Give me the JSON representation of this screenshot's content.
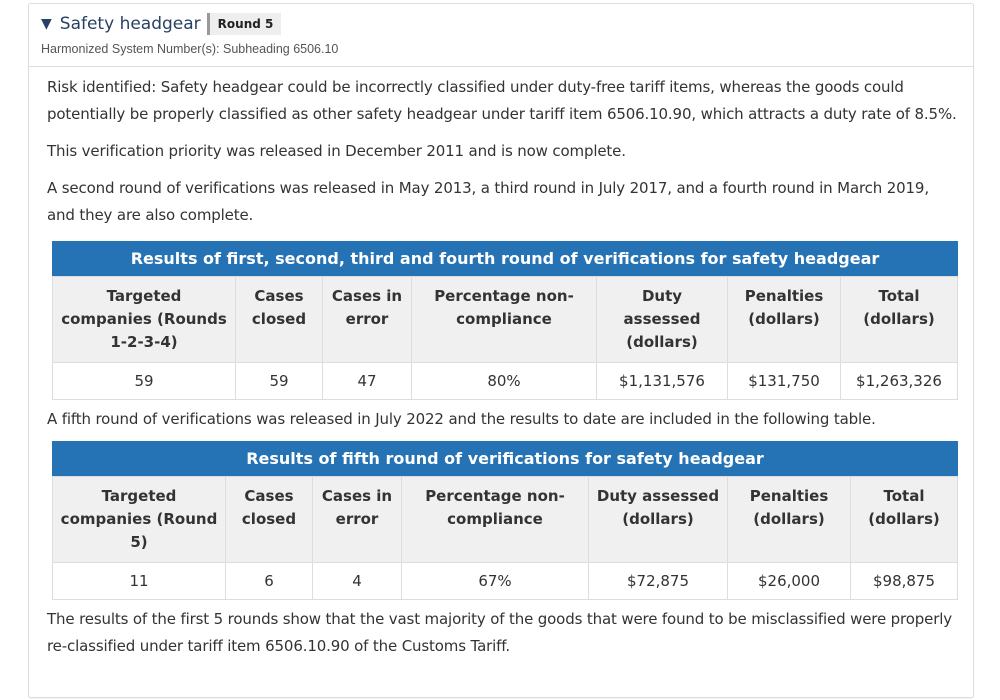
{
  "header": {
    "title": "Safety headgear",
    "badge": "Round 5",
    "hs_number": "Harmonized System Number(s): Subheading 6506.10",
    "toggle_icon": "triangle-down-icon"
  },
  "paragraphs": {
    "risk": "Risk identified: Safety headgear could be incorrectly classified under duty-free tariff items, whereas the goods could potentially be properly classified as other safety headgear under tariff item 6506.10.90, which attracts a duty rate of 8.5%.",
    "released": "This verification priority was released in December 2011 and is now complete.",
    "rounds": "A second round of verifications was released in May 2013, a third round in July 2017, and a fourth round in March 2019, and they are also complete.",
    "fifth": "A fifth round of verifications was released in July 2022 and the results to date are included in the following table.",
    "conclusion": "The results of the first 5 rounds show that the vast majority of the goods that were found to be misclassified were properly re-classified under tariff item 6506.10.90 of the Customs Tariff."
  },
  "table1": {
    "caption": "Results of first, second, third and fourth round of verifications for safety headgear",
    "headers": [
      "Targeted companies (Rounds 1-2-3-4)",
      "Cases closed",
      "Cases in error",
      "Percentage non-compliance",
      "Duty assessed (dollars)",
      "Penalties (dollars)",
      "Total (dollars)"
    ],
    "row": [
      "59",
      "59",
      "47",
      "80%",
      "$1,131,576",
      "$131,750",
      "$1,263,326"
    ]
  },
  "table2": {
    "caption": "Results of fifth round of verifications for safety headgear",
    "headers": [
      "Targeted companies (Round 5)",
      "Cases closed",
      "Cases in error",
      "Percentage non-compliance",
      "Duty assessed (dollars)",
      "Penalties (dollars)",
      "Total (dollars)"
    ],
    "row": [
      "11",
      "6",
      "4",
      "67%",
      "$72,875",
      "$26,000",
      "$98,875"
    ]
  }
}
